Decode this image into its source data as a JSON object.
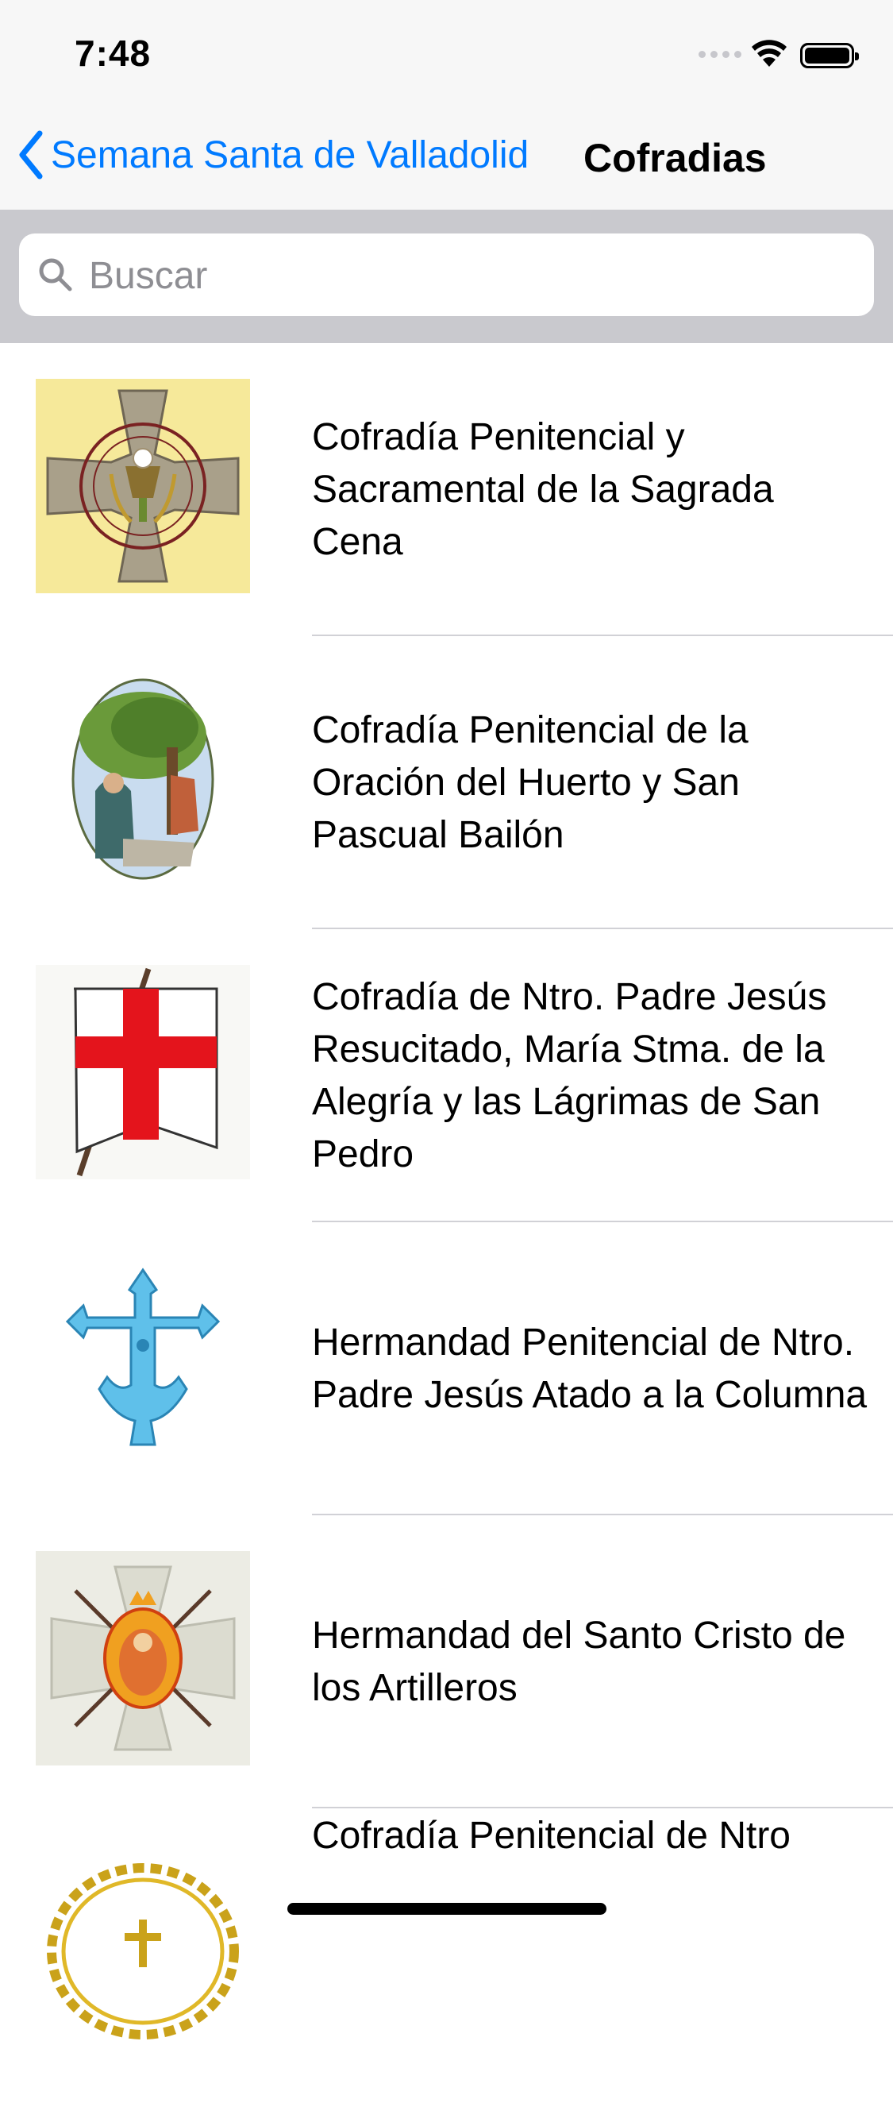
{
  "status_bar": {
    "time": "7:48"
  },
  "nav": {
    "back_label": "Semana Santa de Valladolid",
    "title": "Cofradias"
  },
  "search": {
    "placeholder": "Buscar",
    "value": ""
  },
  "colors": {
    "accent": "#007aff",
    "search_bg": "#c9c9ce",
    "bar_bg": "#f7f7f7"
  },
  "items": [
    {
      "label": "Cofradía Penitencial y Sacramental de la Sagrada Cena",
      "icon": "sagrada-cena-emblem-icon"
    },
    {
      "label": "Cofradía Penitencial de la Oración del Huerto y San Pascual Bailón",
      "icon": "oracion-huerto-medallion-icon"
    },
    {
      "label": "Cofradía de Ntro. Padre Jesús Resucitado, María Stma. de la Alegría y las Lágrimas de San Pedro",
      "icon": "resucitado-banner-icon"
    },
    {
      "label": "Hermandad Penitencial de Ntro. Padre Jesús Atado a la Columna",
      "icon": "atado-columna-cross-icon"
    },
    {
      "label": "Hermandad del Santo Cristo de los Artilleros",
      "icon": "artilleros-cross-icon"
    },
    {
      "label": "Cofradía Penitencial de Ntro",
      "icon": "crown-of-thorns-icon"
    }
  ]
}
